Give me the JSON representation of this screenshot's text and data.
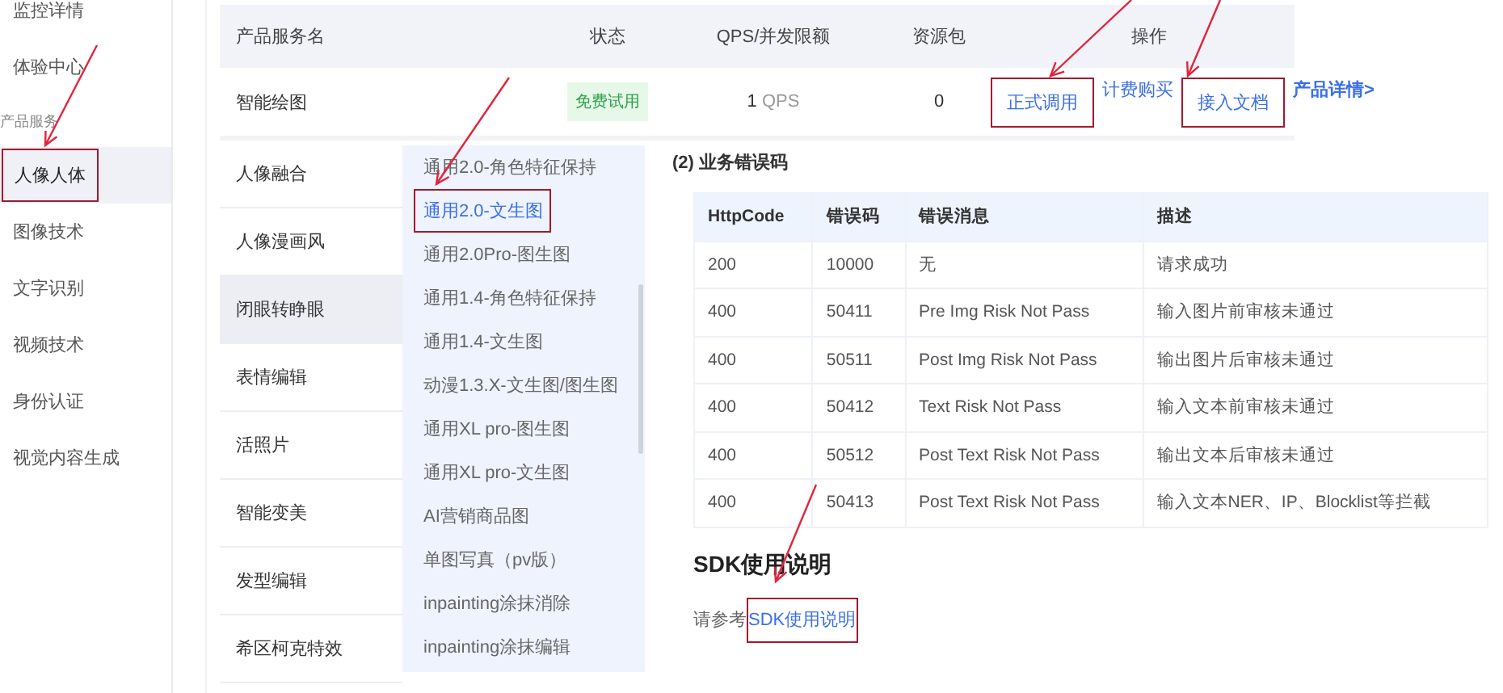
{
  "sidebar": {
    "items": [
      {
        "label": "监控详情",
        "kind": "item",
        "selected": false,
        "highlighted": false
      },
      {
        "label": "体验中心",
        "kind": "item",
        "selected": false,
        "highlighted": false
      },
      {
        "label": "产品服务",
        "kind": "section",
        "selected": false,
        "highlighted": false
      },
      {
        "label": "人像人体",
        "kind": "item",
        "selected": true,
        "highlighted": true
      },
      {
        "label": "图像技术",
        "kind": "item",
        "selected": false,
        "highlighted": false
      },
      {
        "label": "文字识别",
        "kind": "item",
        "selected": false,
        "highlighted": false
      },
      {
        "label": "视频技术",
        "kind": "item",
        "selected": false,
        "highlighted": false
      },
      {
        "label": "身份认证",
        "kind": "item",
        "selected": false,
        "highlighted": false
      },
      {
        "label": "视觉内容生成",
        "kind": "item",
        "selected": false,
        "highlighted": false
      }
    ]
  },
  "services": {
    "columns": [
      "产品服务名",
      "状态",
      "QPS/并发限额",
      "资源包",
      "操作"
    ],
    "row": {
      "name": "智能绘图",
      "status": "免费试用",
      "qps_value": "1",
      "qps_unit": "QPS",
      "package": "0",
      "actions": [
        {
          "label": "正式调用",
          "highlighted": true
        },
        {
          "label": "计费购买",
          "highlighted": false
        },
        {
          "label": "接入文档",
          "highlighted": true
        },
        {
          "label": "产品详情>",
          "highlighted": false
        }
      ]
    },
    "other_rows": [
      {
        "name": "人像融合",
        "selected": false
      },
      {
        "name": "人像漫画风",
        "selected": false
      },
      {
        "name": "闭眼转睁眼",
        "selected": true
      },
      {
        "name": "表情编辑",
        "selected": false
      },
      {
        "name": "活照片",
        "selected": false
      },
      {
        "name": "智能变美",
        "selected": false
      },
      {
        "name": "发型编辑",
        "selected": false
      },
      {
        "name": "希区柯克特效",
        "selected": false
      }
    ]
  },
  "dropdown": {
    "items": [
      {
        "label": "通用2.0-角色特征保持",
        "selected": false,
        "highlighted": false
      },
      {
        "label": "通用2.0-文生图",
        "selected": true,
        "highlighted": true
      },
      {
        "label": "通用2.0Pro-图生图",
        "selected": false,
        "highlighted": false
      },
      {
        "label": "通用1.4-角色特征保持",
        "selected": false,
        "highlighted": false
      },
      {
        "label": "通用1.4-文生图",
        "selected": false,
        "highlighted": false
      },
      {
        "label": "动漫1.3.X-文生图/图生图",
        "selected": false,
        "highlighted": false
      },
      {
        "label": "通用XL pro-图生图",
        "selected": false,
        "highlighted": false
      },
      {
        "label": "通用XL pro-文生图",
        "selected": false,
        "highlighted": false
      },
      {
        "label": "AI营销商品图",
        "selected": false,
        "highlighted": false
      },
      {
        "label": "单图写真（pv版）",
        "selected": false,
        "highlighted": false
      },
      {
        "label": "inpainting涂抹消除",
        "selected": false,
        "highlighted": false
      },
      {
        "label": "inpainting涂抹编辑",
        "selected": false,
        "highlighted": false
      }
    ]
  },
  "doc": {
    "section_title": "(2) 业务错误码",
    "error_table": {
      "columns": [
        "HttpCode",
        "错误码",
        "错误消息",
        "描述"
      ],
      "rows": [
        [
          "200",
          "10000",
          "无",
          "请求成功"
        ],
        [
          "400",
          "50411",
          "Pre Img Risk Not Pass",
          "输入图片前审核未通过"
        ],
        [
          "400",
          "50511",
          "Post Img Risk Not Pass",
          "输出图片后审核未通过"
        ],
        [
          "400",
          "50412",
          "Text Risk Not Pass",
          "输入文本前审核未通过"
        ],
        [
          "400",
          "50512",
          "Post Text Risk Not Pass",
          "输出文本后审核未通过"
        ],
        [
          "400",
          "50413",
          "Post Text Risk Not Pass",
          "输入文本NER、IP、Blocklist等拦截"
        ]
      ]
    },
    "sdk_title": "SDK使用说明",
    "sdk_text": "请参考",
    "sdk_link": {
      "label": "SDK使用说明",
      "highlighted": true
    }
  }
}
